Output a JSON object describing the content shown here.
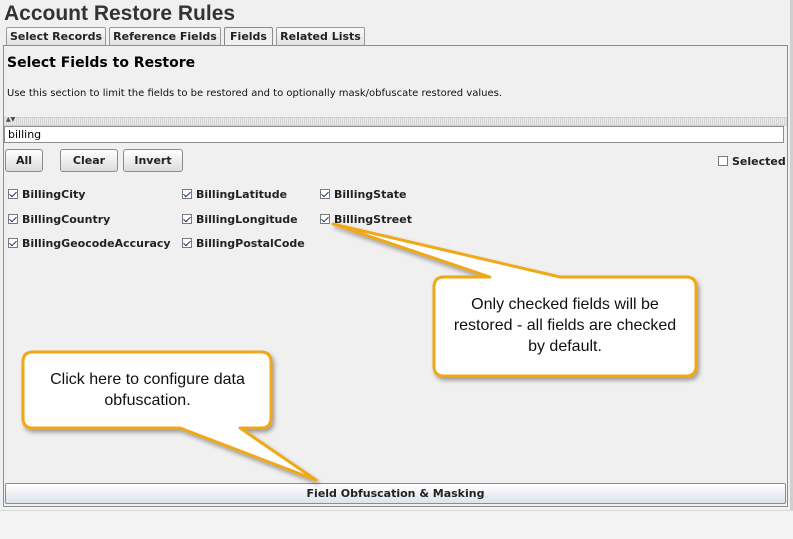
{
  "window": {
    "title": "Account Restore Rules"
  },
  "tabs": [
    {
      "label": "Select Records",
      "active": false
    },
    {
      "label": "Reference Fields",
      "active": false
    },
    {
      "label": "Fields",
      "active": true
    },
    {
      "label": "Related Lists",
      "active": false
    }
  ],
  "section": {
    "title": "Select Fields to Restore",
    "description": "Use this section to limit the fields to be restored and to optionally mask/obfuscate restored values."
  },
  "search": {
    "value": "billing",
    "placeholder": ""
  },
  "toolbar": {
    "all_label": "All",
    "clear_label": "Clear",
    "invert_label": "Invert",
    "selected_label": "Selected",
    "selected_checked": false
  },
  "fields": [
    {
      "label": "BillingCity",
      "checked": true
    },
    {
      "label": "BillingCountry",
      "checked": true
    },
    {
      "label": "BillingGeocodeAccuracy",
      "checked": true
    },
    {
      "label": "BillingLatitude",
      "checked": true
    },
    {
      "label": "BillingLongitude",
      "checked": true
    },
    {
      "label": "BillingPostalCode",
      "checked": true
    },
    {
      "label": "BillingState",
      "checked": true
    },
    {
      "label": "BillingStreet",
      "checked": true
    }
  ],
  "bottom_button": {
    "label": "Field Obfuscation & Masking"
  },
  "callouts": {
    "checked_fields": "Only checked fields will be restored - all fields are checked by default.",
    "obfuscation": "Click here to configure data obfuscation."
  },
  "colors": {
    "callout_border": "#f0a818",
    "callout_fill": "#ffffff"
  }
}
